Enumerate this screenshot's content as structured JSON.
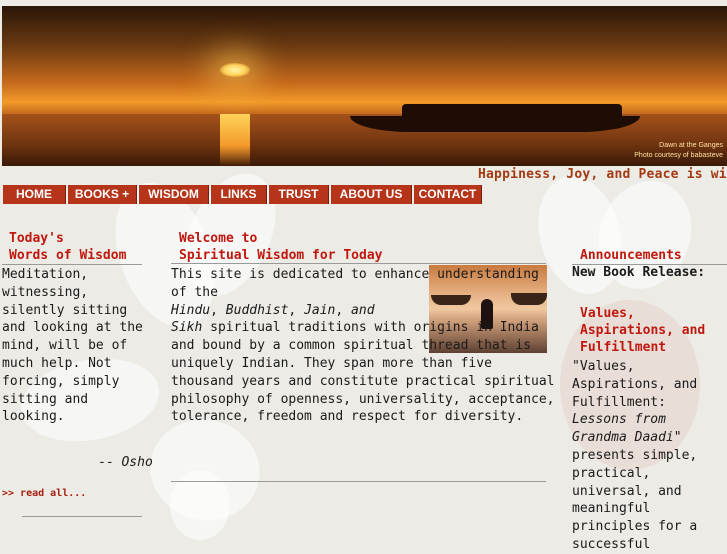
{
  "banner": {
    "caption_line1": "Dawn at the Ganges",
    "caption_line2": "Photo courtesy of babasteve"
  },
  "tagline": "Happiness, Joy, and Peace is wi",
  "nav": [
    {
      "label": "HOME"
    },
    {
      "label": "BOOKS"
    },
    {
      "label": "WISDOM"
    },
    {
      "label": "LINKS"
    },
    {
      "label": "TRUST"
    },
    {
      "label": "ABOUT US"
    },
    {
      "label": "CONTACT"
    }
  ],
  "nav_books_indicator": "+",
  "left": {
    "heading_line1": "Today's",
    "heading_line2": "Words of Wisdom",
    "quote": "Meditation, witnessing, silently sitting and looking at the mind, will be of much help. Not forcing, simply sitting and looking.",
    "author_prefix": "-- ",
    "author": "Osho",
    "read_all": ">> read all..."
  },
  "center": {
    "heading_line1": "Welcome to",
    "heading_line2": "Spiritual Wisdom for Today",
    "p1": "This site is dedicated to enhance understanding of the",
    "hindu": "Hindu",
    "buddhist": "Buddhist",
    "jain": "Jain",
    "and": "and",
    "sikh": "Sikh",
    "p2": " spiritual traditions with origins in India and bound by a common spiritual thread that is uniquely Indian. They span more than five thousand years and constitute practical spiritual philosophy of openness, universality, acceptance, tolerance, freedom and respect for diversity."
  },
  "right": {
    "heading": "Announcements",
    "new_book": "New Book Release:",
    "book_title_line1": "Values,",
    "book_title_line2": "Aspirations, and",
    "book_title_line3": "Fulfillment",
    "desc_open": "\"Values, Aspirations, and Fulfillment: ",
    "desc_italic": "Lessons from Grandma Daadi",
    "desc_close": "\" presents simple, practical, universal, and meaningful principles for a successful"
  }
}
